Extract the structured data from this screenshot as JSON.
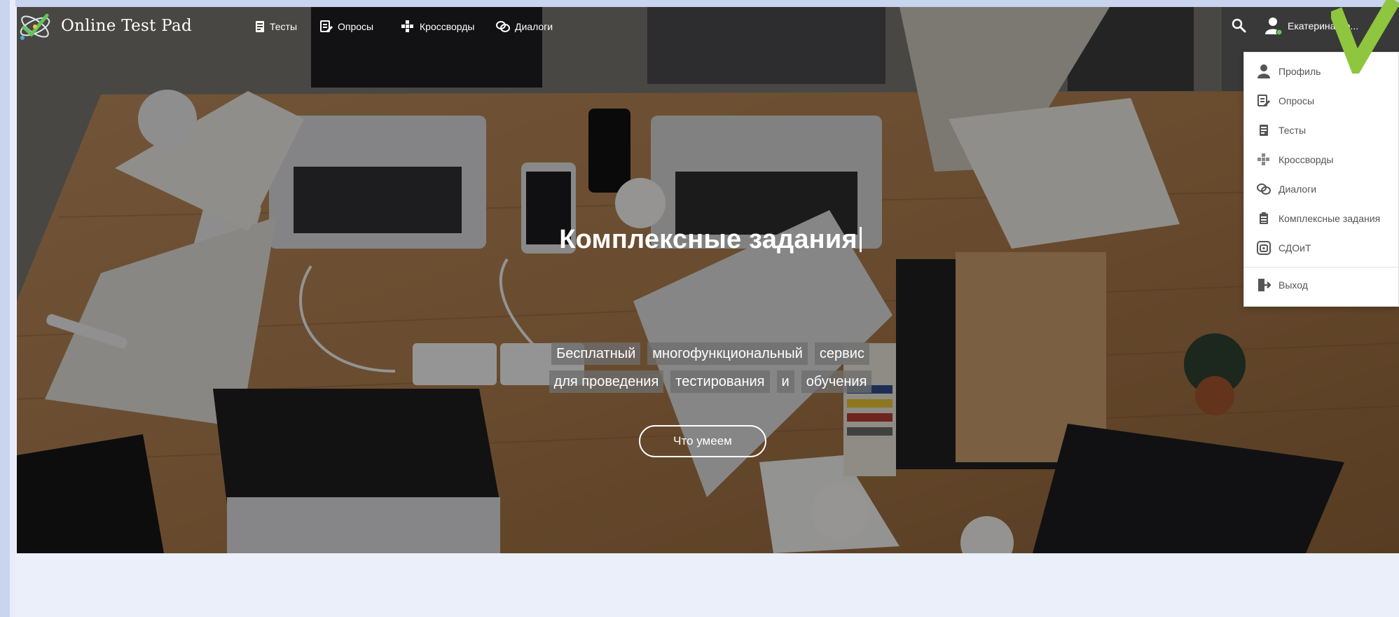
{
  "header": {
    "brand": "Online Test Pad",
    "nav": [
      {
        "label": "Тесты",
        "icon": "test-icon"
      },
      {
        "label": "Опросы",
        "icon": "poll-icon"
      },
      {
        "label": "Кроссворды",
        "icon": "crossword-icon"
      },
      {
        "label": "Диалоги",
        "icon": "dialog-icon"
      }
    ],
    "user_name": "Екатерина Во..."
  },
  "user_menu": {
    "items": [
      {
        "label": "Профиль",
        "icon": "profile-icon"
      },
      {
        "label": "Опросы",
        "icon": "poll-icon"
      },
      {
        "label": "Тесты",
        "icon": "test-icon"
      },
      {
        "label": "Кроссворды",
        "icon": "crossword-icon"
      },
      {
        "label": "Диалоги",
        "icon": "dialog-icon"
      },
      {
        "label": "Комплексные задания",
        "icon": "complex-task-icon"
      },
      {
        "label": "СДОиТ",
        "icon": "sdoit-icon"
      }
    ],
    "logout_label": "Выход"
  },
  "hero": {
    "headline": "Комплексные задания",
    "tagline_words": [
      "Бесплатный",
      "многофункциональный",
      "сервис",
      "для проведения",
      "тестирования",
      "и",
      "обучения"
    ],
    "cta_label": "Что умеем"
  },
  "colors": {
    "accent_check": "#8fc63f",
    "menu_text": "#555555",
    "frame": "#c9d4ee",
    "page_bg": "#eaeff9"
  }
}
